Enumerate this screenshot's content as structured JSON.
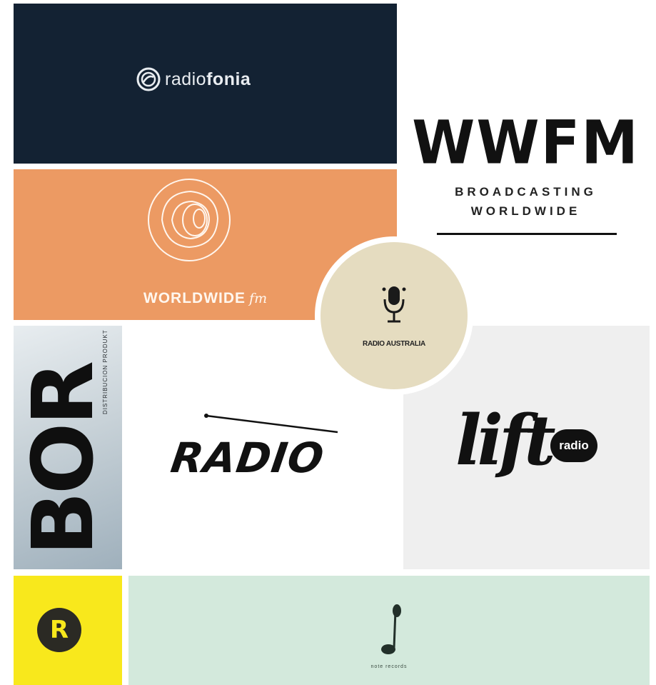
{
  "tiles": {
    "radiofonia": {
      "text_light": "radio",
      "text_bold": "fonia",
      "background": "#132233"
    },
    "worldwide": {
      "main": "WORLDWIDE",
      "suffix": "fm",
      "background": "#ec9a63"
    },
    "wwfm": {
      "title": "WWFM",
      "subtitle_line1": "BROADCASTING",
      "subtitle_line2": "WORLDWIDE"
    },
    "radio_australia": {
      "label": "RADIO AUSTRALIA",
      "background": "#e5dcc0"
    },
    "bor": {
      "letters": "BOR",
      "subtitle": "DISTRIBUCION PRODUKT"
    },
    "radio": {
      "text": "RADIO"
    },
    "lift": {
      "text": "lift",
      "badge": "radio"
    },
    "yellow_badge": {
      "letter": "R",
      "background": "#f8e81c"
    },
    "mint": {
      "label": "note records",
      "background": "#d3e9dc"
    }
  },
  "icons": [
    "radiofonia-logo-icon",
    "concentric-rings-icon",
    "microphone-icon",
    "antenna-icon",
    "music-note-icon"
  ]
}
